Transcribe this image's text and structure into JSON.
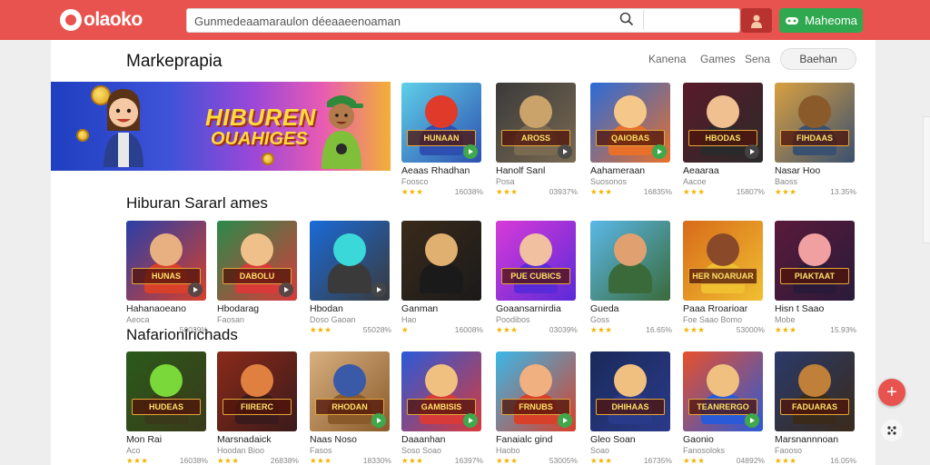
{
  "header": {
    "logo": "olaoko",
    "search_value": "Gunmedeaamaraulon déeaaeenoaman",
    "promo_label": "Maheoma",
    "accent": "#e8534f",
    "promo_color": "#2fa84f",
    "icons": {
      "search": "search-icon",
      "user": "user-icon",
      "promo": "controller-icon"
    }
  },
  "page": {
    "title": "Markeprapia",
    "nav": [
      "Kanena",
      "Games",
      "Sena"
    ],
    "filter_label": "Baehan"
  },
  "banner": {
    "title": "HIBUREN",
    "subtitle": "OUAHIGES"
  },
  "sections": [
    {
      "title": "Hiburan Sararl ames"
    },
    {
      "title": "Nafarionlrichads"
    }
  ],
  "rows": [
    [
      {
        "name": "Aeaas Rhadhan",
        "sub": "Foosco",
        "stars": "★★★",
        "stat": "16038%",
        "label": "HUNAAN",
        "badge": "green",
        "colors": [
          "#5fd0e8",
          "#e03a2a",
          "#2d4fb0"
        ]
      },
      {
        "name": "Hanolf Sanl",
        "sub": "Posa",
        "stars": "★★★",
        "stat": "03937%",
        "label": "AROSS",
        "badge": "dark",
        "colors": [
          "#3a3a3a",
          "#c9a36a",
          "#7a6a52"
        ]
      },
      {
        "name": "Aahameraan",
        "sub": "Suosonos",
        "stars": "★★★",
        "stat": "16835%",
        "label": "QAIOBAS",
        "badge": "green",
        "colors": [
          "#2a6cd8",
          "#f5c88a",
          "#e8702a"
        ]
      },
      {
        "name": "Aeaaraa",
        "sub": "Aacoe",
        "stars": "★★★",
        "stat": "15807%",
        "label": "HBODAS",
        "badge": "dark",
        "colors": [
          "#5a1a2a",
          "#f0c090",
          "#2a2a2a"
        ]
      },
      {
        "name": "Nasar Hoo",
        "sub": "Baoss",
        "stars": "★★★",
        "stat": "13.35%",
        "label": "FIHDAAS",
        "badge": "none",
        "colors": [
          "#d8a040",
          "#8a5a2a",
          "#3a5070"
        ]
      }
    ],
    [
      {
        "name": "Hahanaoeano",
        "sub": "Aeoca",
        "stars": "",
        "stat": "50039%",
        "label": "HUNAS",
        "badge": "dark",
        "colors": [
          "#2a3fa8",
          "#e8b080",
          "#d8402a"
        ]
      },
      {
        "name": "Hbodarag",
        "sub": "Faosan",
        "stars": "",
        "stat": "",
        "label": "DABOLU",
        "badge": "dark",
        "colors": [
          "#2a8a4a",
          "#f0c08a",
          "#d83a3a"
        ]
      },
      {
        "name": "Hbodan",
        "sub": "Doso Gaoan",
        "stars": "★★★",
        "stat": "55028%",
        "label": "",
        "badge": "dark",
        "colors": [
          "#1a6ad8",
          "#3ad8d8",
          "#3a3a3a"
        ]
      },
      {
        "name": "Ganman",
        "sub": "Hao",
        "stars": "★",
        "stat": "16008%",
        "label": "",
        "badge": "none",
        "colors": [
          "#3a2a1a",
          "#e0b070",
          "#1a1a1a"
        ]
      },
      {
        "name": "Goaansarnirdia",
        "sub": "Poodibos",
        "stars": "★★★",
        "stat": "03039%",
        "label": "PUE CUBICS",
        "badge": "none",
        "colors": [
          "#d83ad8",
          "#f0c0a0",
          "#5a2ad8"
        ]
      },
      {
        "name": "Gueda",
        "sub": "Goss",
        "stars": "★★★",
        "stat": "16.65%",
        "label": "",
        "badge": "none",
        "colors": [
          "#5ab8e8",
          "#e0a070",
          "#3a6a3a"
        ]
      },
      {
        "name": "Paaa Rroarioar",
        "sub": "Foe Saao Bomo",
        "stars": "★★★",
        "stat": "53000%",
        "label": "HER NOARUAR",
        "badge": "none",
        "colors": [
          "#d86a1a",
          "#8a4a2a",
          "#f0c030"
        ]
      },
      {
        "name": "Hisn t Saao",
        "sub": "Mobe",
        "stars": "★★★",
        "stat": "15.93%",
        "label": "PIAKTAAT",
        "badge": "none",
        "colors": [
          "#5a1a3a",
          "#f0a0a0",
          "#2a1a3a"
        ]
      }
    ],
    [
      {
        "name": "Mon Rai",
        "sub": "Aco",
        "stars": "★★★",
        "stat": "16038%",
        "label": "HUDEAS",
        "badge": "none",
        "colors": [
          "#2a5a1a",
          "#7ad83a",
          "#3a3a1a"
        ]
      },
      {
        "name": "Marsnadaick",
        "sub": "Hoodan Bioo",
        "stars": "★★★",
        "stat": "26838%",
        "label": "FIIRERC",
        "badge": "none",
        "colors": [
          "#8a2a1a",
          "#e08040",
          "#3a1a1a"
        ]
      },
      {
        "name": "Naas Noso",
        "sub": "Fasos",
        "stars": "★★★",
        "stat": "18330%",
        "label": "RHODAN",
        "badge": "green",
        "colors": [
          "#d8b080",
          "#3a5aa8",
          "#8a5a2a"
        ]
      },
      {
        "name": "Daaanhan",
        "sub": "Soso Soao",
        "stars": "★★★",
        "stat": "16397%",
        "label": "GAMBISIS",
        "badge": "green",
        "colors": [
          "#2a5ad8",
          "#f0c080",
          "#d83a3a"
        ]
      },
      {
        "name": "Fanaialc gind",
        "sub": "Haobo",
        "stars": "★★★",
        "stat": "53005%",
        "label": "FRNUBS",
        "badge": "green",
        "colors": [
          "#3ab8e8",
          "#f0b080",
          "#d8402a"
        ]
      },
      {
        "name": "Gleo Soan",
        "sub": "Soao",
        "stars": "★★★",
        "stat": "16735%",
        "label": "DHIHAAS",
        "badge": "none",
        "colors": [
          "#1a2a5a",
          "#f0c080",
          "#2a3a8a"
        ]
      },
      {
        "name": "Gaonio",
        "sub": "Fanosoloks",
        "stars": "★★★",
        "stat": "04892%",
        "label": "TEANRERGO",
        "badge": "green",
        "colors": [
          "#e8502a",
          "#f0c080",
          "#2a5ad8"
        ]
      },
      {
        "name": "Marsnannnoan",
        "sub": "Faooso",
        "stars": "★★★",
        "stat": "16.05%",
        "label": "FADUARAS",
        "badge": "none",
        "colors": [
          "#2a3a6a",
          "#c0803a",
          "#3a2a1a"
        ]
      }
    ]
  ]
}
